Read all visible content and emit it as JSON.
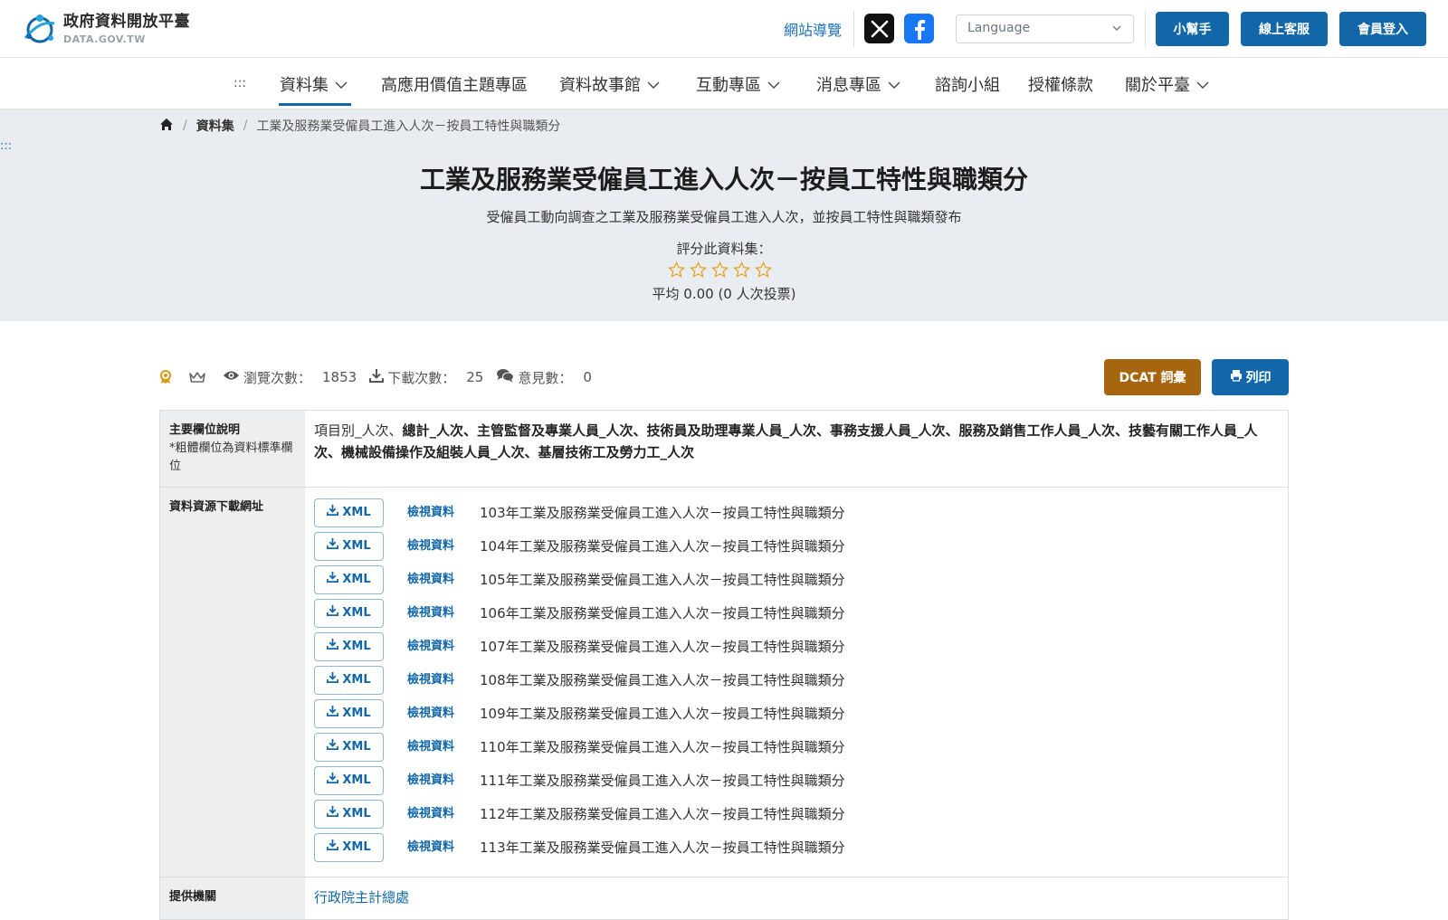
{
  "header": {
    "logo_title": "政府資料開放平臺",
    "logo_sub": "DATA.GOV.TW",
    "site_guide": "網站導覽",
    "language_placeholder": "Language",
    "helper_btn": "小幫手",
    "service_btn": "線上客服",
    "login_btn": "會員登入",
    "colors": {
      "primary": "#1167a8",
      "accent_gold": "#a8650f"
    }
  },
  "nav": {
    "accesskey": ":::",
    "items": [
      {
        "label": "資料集",
        "dropdown": true,
        "active": true
      },
      {
        "label": "高應用價值主題專區",
        "dropdown": false
      },
      {
        "label": "資料故事館",
        "dropdown": true
      },
      {
        "label": "互動專區",
        "dropdown": true
      },
      {
        "label": "消息專區",
        "dropdown": true
      },
      {
        "label": "諮詢小組",
        "dropdown": false
      },
      {
        "label": "授權條款",
        "dropdown": false
      },
      {
        "label": "關於平臺",
        "dropdown": true
      }
    ]
  },
  "breadcrumb": {
    "section": "資料集",
    "current": "工業及服務業受僱員工進入人次－按員工特性與職類分",
    "accesskey": ":::"
  },
  "dataset": {
    "title": "工業及服務業受僱員工進入人次－按員工特性與職類分",
    "description": "受僱員工動向調查之工業及服務業受僱員工進入人次，並按員工特性與職類發布",
    "rating_label": "評分此資料集：",
    "rating_stars_filled": 0,
    "rating_stars_total": 5,
    "rating_avg": "平均 0.00 (0 人次投票)"
  },
  "stats": {
    "views_label": "瀏覽次數：",
    "views": "1853",
    "downloads_label": "下載次數：",
    "downloads": "25",
    "comments_label": "意見數：",
    "comments": "0",
    "dcat_btn": "DCAT 詞彙",
    "print_btn": "列印"
  },
  "meta": {
    "fields_key": "主要欄位說明",
    "fields_note": "*粗體欄位為資料標準欄位",
    "fields_plain": "項目別_人次、",
    "fields_bold": "總計_人次、主管監督及專業人員_人次、技術員及助理專業人員_人次、事務支援人員_人次、服務及銷售工作人員_人次、技藝有關工作人員_人次、機械設備操作及組裝人員_人次、基層技術工及勞力工_人次",
    "resources_key": "資料資源下載網址",
    "xml_label": "XML",
    "view_label": "檢視資料",
    "resources": [
      "103年工業及服務業受僱員工進入人次－按員工特性與職類分",
      "104年工業及服務業受僱員工進入人次－按員工特性與職類分",
      "105年工業及服務業受僱員工進入人次－按員工特性與職類分",
      "106年工業及服務業受僱員工進入人次－按員工特性與職類分",
      "107年工業及服務業受僱員工進入人次－按員工特性與職類分",
      "108年工業及服務業受僱員工進入人次－按員工特性與職類分",
      "109年工業及服務業受僱員工進入人次－按員工特性與職類分",
      "110年工業及服務業受僱員工進入人次－按員工特性與職類分",
      "111年工業及服務業受僱員工進入人次－按員工特性與職類分",
      "112年工業及服務業受僱員工進入人次－按員工特性與職類分",
      "113年工業及服務業受僱員工進入人次－按員工特性與職類分"
    ],
    "provider_key": "提供機關",
    "provider": "行政院主計總處"
  }
}
